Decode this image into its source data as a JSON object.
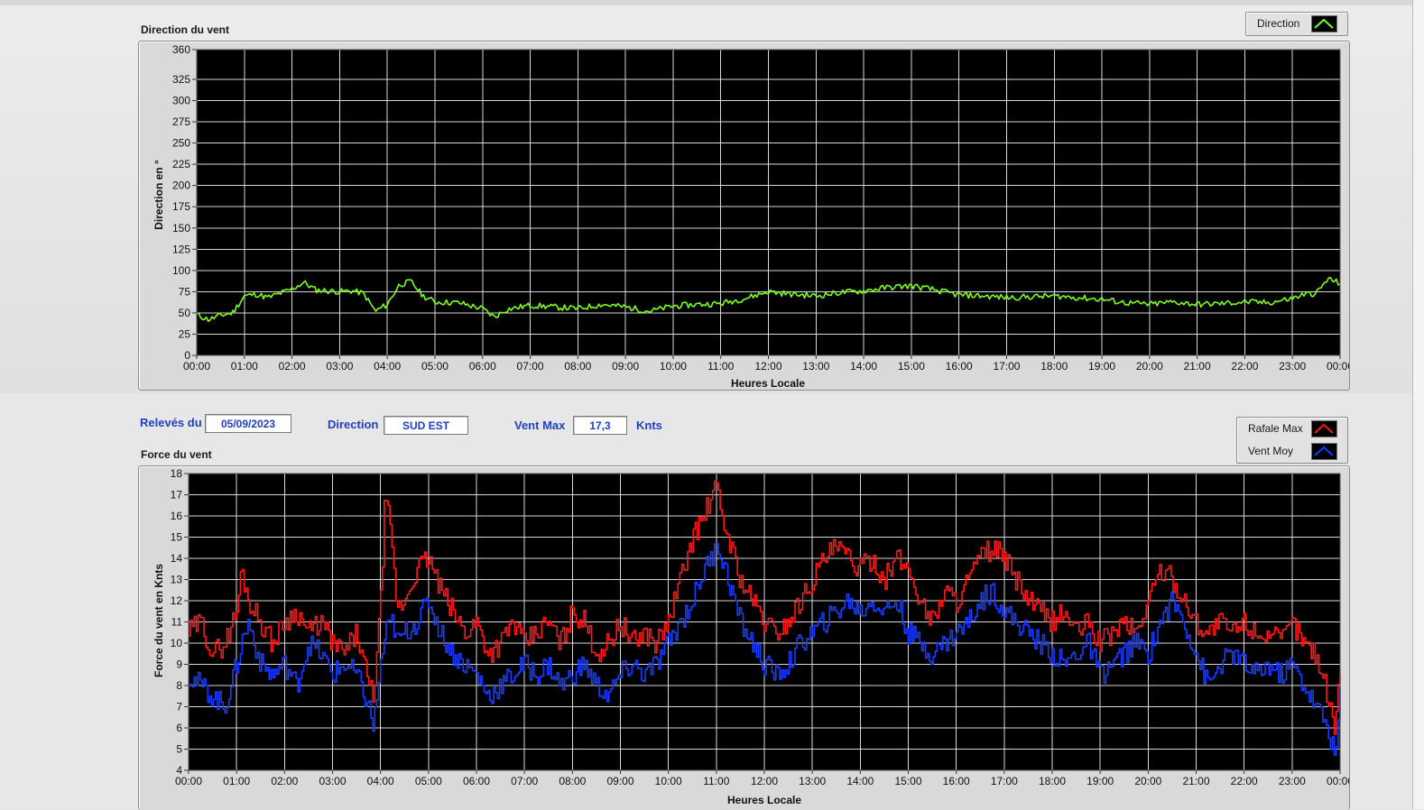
{
  "direction_chart": {
    "caption": "Direction du vent",
    "ylabel": "Direction en °",
    "xlabel": "Heures Locale",
    "legend": [
      {
        "label": "Direction",
        "color": "#7cff1a"
      }
    ]
  },
  "info": {
    "date_label": "Relevés du",
    "date_value": "05/09/2023",
    "direction_label": "Direction",
    "direction_value": "SUD EST",
    "ventmax_label": "Vent Max",
    "ventmax_value": "17,3",
    "ventmax_unit": "Knts"
  },
  "force_chart": {
    "caption": "Force du vent",
    "ylabel": "Force du vent en Knts",
    "xlabel": "Heures Locale",
    "legend": [
      {
        "label": "Rafale Max",
        "color": "#ff1a1a"
      },
      {
        "label": "Vent Moy",
        "color": "#1a3cff"
      }
    ]
  },
  "chart_data": [
    {
      "type": "line",
      "title": "Direction du vent",
      "xlabel": "Heures Locale",
      "ylabel": "Direction en °",
      "ylim": [
        0,
        360
      ],
      "yticks": [
        0,
        25,
        50,
        75,
        100,
        125,
        150,
        175,
        200,
        225,
        250,
        275,
        300,
        325,
        360
      ],
      "x_ticks": [
        "00:00",
        "01:00",
        "02:00",
        "03:00",
        "04:00",
        "05:00",
        "06:00",
        "07:00",
        "08:00",
        "09:00",
        "10:00",
        "11:00",
        "12:00",
        "13:00",
        "14:00",
        "15:00",
        "16:00",
        "17:00",
        "18:00",
        "19:00",
        "20:00",
        "21:00",
        "22:00",
        "23:00",
        "00:00"
      ],
      "grid": true,
      "series": [
        {
          "name": "Direction",
          "color": "#7cff1a",
          "x_hours": [
            0,
            0.25,
            0.5,
            0.75,
            1,
            1.25,
            1.5,
            1.75,
            2,
            2.25,
            2.5,
            2.75,
            3,
            3.25,
            3.5,
            3.75,
            4,
            4.25,
            4.5,
            4.75,
            5,
            5.5,
            6,
            6.25,
            6.5,
            7,
            7.5,
            8,
            8.5,
            9,
            9.5,
            10,
            10.5,
            11,
            11.5,
            12,
            12.5,
            13,
            13.5,
            14,
            14.5,
            15,
            15.5,
            16,
            16.5,
            17,
            17.5,
            18,
            18.5,
            19,
            19.5,
            20,
            20.5,
            21,
            21.5,
            22,
            22.5,
            23,
            23.25,
            23.5,
            23.75,
            24
          ],
          "values": [
            48,
            42,
            47,
            50,
            70,
            72,
            68,
            73,
            78,
            86,
            77,
            76,
            75,
            76,
            73,
            52,
            60,
            83,
            87,
            70,
            63,
            62,
            55,
            45,
            54,
            59,
            57,
            55,
            60,
            57,
            52,
            58,
            60,
            61,
            67,
            75,
            72,
            70,
            74,
            76,
            80,
            82,
            77,
            71,
            70,
            68,
            69,
            70,
            68,
            66,
            62,
            60,
            63,
            60,
            61,
            63,
            62,
            67,
            72,
            73,
            90,
            85
          ]
        }
      ]
    },
    {
      "type": "line",
      "title": "Force du vent",
      "xlabel": "Heures Locale",
      "ylabel": "Force du vent en Knts",
      "ylim": [
        4,
        18
      ],
      "yticks": [
        4,
        5,
        6,
        7,
        8,
        9,
        10,
        11,
        12,
        13,
        14,
        15,
        16,
        17,
        18
      ],
      "x_ticks": [
        "00:00",
        "01:00",
        "02:00",
        "03:00",
        "04:00",
        "05:00",
        "06:00",
        "07:00",
        "08:00",
        "09:00",
        "10:00",
        "11:00",
        "12:00",
        "13:00",
        "14:00",
        "15:00",
        "16:00",
        "17:00",
        "18:00",
        "19:00",
        "20:00",
        "21:00",
        "22:00",
        "23:00",
        "00:00"
      ],
      "grid": true,
      "series": [
        {
          "name": "Rafale Max",
          "color": "#ff1a1a",
          "x_hours": [
            0,
            0.25,
            0.5,
            0.75,
            1,
            1.1,
            1.25,
            1.5,
            1.75,
            2,
            2.25,
            2.5,
            2.75,
            3,
            3.25,
            3.5,
            3.75,
            3.85,
            4,
            4.1,
            4.25,
            4.35,
            4.5,
            4.75,
            5,
            5.25,
            5.5,
            5.75,
            6,
            6.25,
            6.5,
            6.75,
            7,
            7.25,
            7.5,
            7.75,
            8,
            8.25,
            8.5,
            8.75,
            9,
            9.25,
            9.5,
            9.75,
            10,
            10.25,
            10.5,
            10.75,
            10.9,
            11,
            11.1,
            11.25,
            11.5,
            11.75,
            12,
            12.25,
            12.5,
            12.75,
            13,
            13.25,
            13.5,
            13.75,
            14,
            14.25,
            14.5,
            14.75,
            15,
            15.25,
            15.5,
            15.75,
            16,
            16.25,
            16.5,
            16.75,
            17,
            17.25,
            17.5,
            17.75,
            18,
            18.25,
            18.5,
            18.75,
            19,
            19.25,
            19.5,
            19.75,
            20,
            20.25,
            20.5,
            20.75,
            21,
            21.25,
            21.5,
            21.75,
            22,
            22.25,
            22.5,
            22.75,
            23,
            23.25,
            23.5,
            23.75,
            23.9,
            24
          ],
          "values": [
            10.5,
            11,
            9.5,
            10,
            11.5,
            13.5,
            12,
            11,
            10,
            11,
            11.5,
            10.5,
            11,
            10,
            9.5,
            10.5,
            8,
            7.5,
            12,
            17.3,
            14,
            11.5,
            12,
            13.5,
            14,
            12.5,
            11.5,
            10.5,
            11,
            9.5,
            10,
            11,
            10,
            10.5,
            11,
            10,
            11.5,
            11,
            9.5,
            10,
            11,
            10,
            10.5,
            10,
            11,
            13,
            15,
            16,
            17,
            17.3,
            16,
            15,
            13,
            12,
            11,
            10.5,
            11,
            12,
            13,
            14,
            14.5,
            14,
            13.5,
            14,
            13,
            14,
            13.5,
            12,
            11,
            12.5,
            12,
            13,
            14,
            14.5,
            14,
            13,
            12,
            11.5,
            11,
            11.5,
            10.5,
            11,
            10,
            10.5,
            11,
            10.5,
            12,
            13.5,
            13,
            12,
            11,
            10.5,
            11,
            10.5,
            11,
            10.5,
            10.5,
            10,
            11,
            10,
            9.5,
            7.5,
            6,
            8.5
          ]
        },
        {
          "name": "Vent Moy",
          "color": "#1a3cff",
          "x_hours": [
            0,
            0.25,
            0.5,
            0.75,
            1,
            1.1,
            1.25,
            1.5,
            1.75,
            2,
            2.25,
            2.5,
            2.75,
            3,
            3.25,
            3.5,
            3.75,
            3.85,
            4,
            4.1,
            4.25,
            4.35,
            4.5,
            4.75,
            5,
            5.25,
            5.5,
            5.75,
            6,
            6.25,
            6.5,
            6.75,
            7,
            7.25,
            7.5,
            7.75,
            8,
            8.25,
            8.5,
            8.75,
            9,
            9.25,
            9.5,
            9.75,
            10,
            10.25,
            10.5,
            10.75,
            10.9,
            11,
            11.1,
            11.25,
            11.5,
            11.75,
            12,
            12.25,
            12.5,
            12.75,
            13,
            13.25,
            13.5,
            13.75,
            14,
            14.25,
            14.5,
            14.75,
            15,
            15.25,
            15.5,
            15.75,
            16,
            16.25,
            16.5,
            16.75,
            17,
            17.25,
            17.5,
            17.75,
            18,
            18.25,
            18.5,
            18.75,
            19,
            19.25,
            19.5,
            19.75,
            20,
            20.25,
            20.5,
            20.75,
            21,
            21.25,
            21.5,
            21.75,
            22,
            22.25,
            22.5,
            22.75,
            23,
            23.25,
            23.5,
            23.75,
            23.9,
            24
          ],
          "values": [
            8.5,
            8,
            7.5,
            7,
            9,
            10,
            11,
            9,
            8.5,
            9,
            8,
            10,
            9.5,
            8.5,
            9,
            8.5,
            7,
            6,
            9,
            10.5,
            11,
            10,
            10.5,
            11,
            12,
            10.5,
            9.5,
            9,
            8.5,
            7.5,
            8,
            8.5,
            9,
            8.5,
            9,
            8,
            8.5,
            9,
            8,
            7.5,
            8.5,
            9,
            8.5,
            9,
            10,
            11,
            12,
            13.5,
            14,
            15,
            14,
            13,
            11,
            10,
            9,
            8.5,
            9,
            10,
            10.5,
            11,
            11.5,
            12,
            11.5,
            12,
            11.5,
            12,
            10.5,
            10,
            9.5,
            10,
            10.5,
            11,
            12,
            12.5,
            11.5,
            11,
            10.5,
            10,
            9.5,
            9,
            9.5,
            10,
            8.5,
            9,
            9.5,
            10,
            9.5,
            11,
            12,
            11,
            9.5,
            8,
            9,
            9.5,
            9,
            8.5,
            9,
            8.5,
            9,
            8,
            7,
            6,
            4.5,
            7.5
          ]
        }
      ]
    }
  ]
}
